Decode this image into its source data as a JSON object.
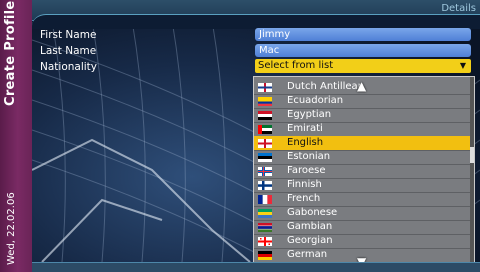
{
  "sidebar": {
    "title": "Create Profile",
    "date": "Wed, 22.02.06"
  },
  "topbar": {
    "tab": "Details"
  },
  "form": {
    "first_name_label": "First Name",
    "first_name_value": "Jimmy",
    "last_name_label": "Last Name",
    "last_name_value": "Mac",
    "nationality_label": "Nationality",
    "nationality_value": "Select from list"
  },
  "nationality_list": {
    "items": [
      {
        "label": "Dutch Antillean",
        "flag": "dutch-antillean-flag"
      },
      {
        "label": "Ecuadorian",
        "flag": "ecuador-flag"
      },
      {
        "label": "Egyptian",
        "flag": "egypt-flag"
      },
      {
        "label": "Emirati",
        "flag": "uae-flag"
      },
      {
        "label": "English",
        "flag": "england-flag",
        "selected": true
      },
      {
        "label": "Estonian",
        "flag": "estonia-flag"
      },
      {
        "label": "Faroese",
        "flag": "faroe-flag"
      },
      {
        "label": "Finnish",
        "flag": "finland-flag"
      },
      {
        "label": "French",
        "flag": "france-flag"
      },
      {
        "label": "Gabonese",
        "flag": "gabon-flag"
      },
      {
        "label": "Gambian",
        "flag": "gambia-flag"
      },
      {
        "label": "Georgian",
        "flag": "georgia-flag"
      },
      {
        "label": "German",
        "flag": "germany-flag"
      }
    ]
  },
  "colors": {
    "selected": "#f2bf10",
    "field": "#5f8fdc",
    "sidebar": "#6a2457"
  }
}
